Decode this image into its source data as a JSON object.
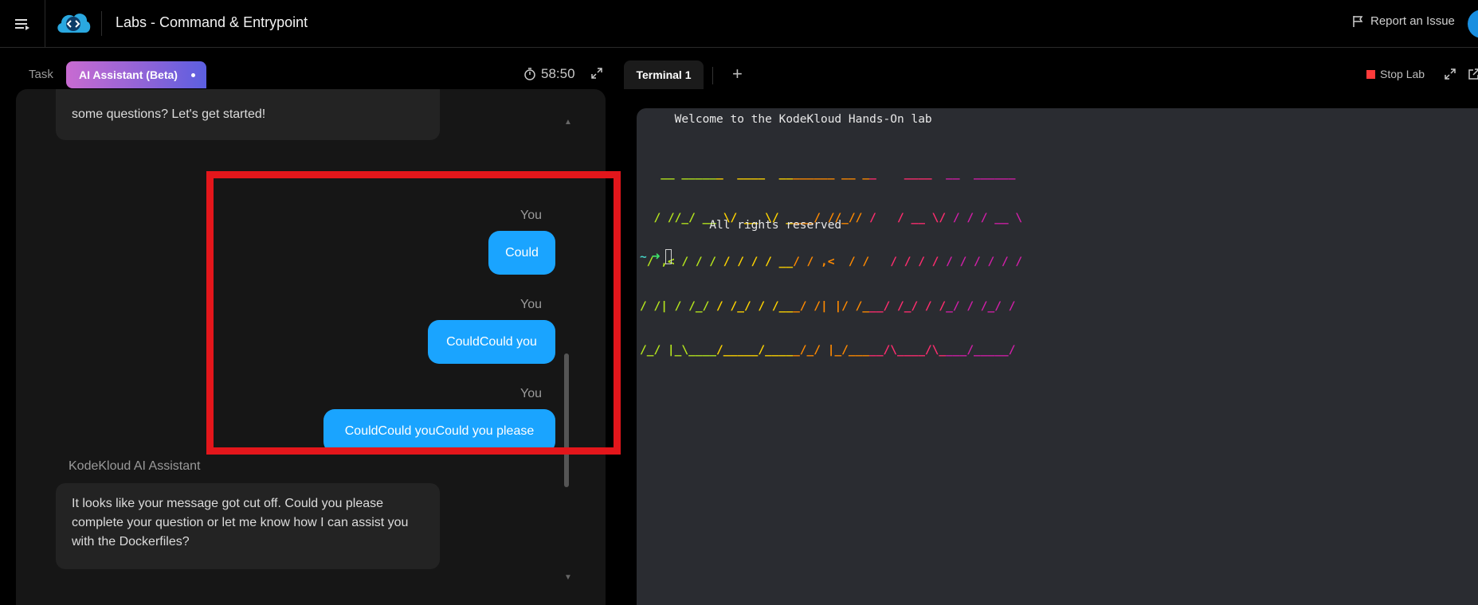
{
  "header": {
    "title": "Labs - Command & Entrypoint",
    "report_label": "Report an Issue"
  },
  "left_tabs": {
    "task": "Task",
    "ai": "AI Assistant (Beta)",
    "timer": "58:50"
  },
  "chat": {
    "top_ai_text": "some questions? Let's get started!",
    "you_label": "You",
    "user_messages": [
      "Could",
      "CouldCould you",
      "CouldCould youCould you please"
    ],
    "ai_name": "KodeKloud AI Assistant",
    "ai_reply": "It looks like your message got cut off. Could you please complete your question or let me know how I can assist you with the Dockerfiles?"
  },
  "terminal": {
    "tab_label": "Terminal 1",
    "add_label": "+",
    "stop_label": "Stop Lab",
    "welcome": "     Welcome to the KodeKloud Hands-On lab",
    "ascii_lines": [
      "   __ ______  ____  ________ __ __    ____  __  ______",
      "  / //_/ __ \\/ __ \\/ ____/ //_// /   / __ \\/ / / / __ \\",
      " / ,< / / / / / / / __/ / ,<  / /   / / / / / / / / / /",
      "/ /| / /_/ / /_/ / /___/ /| |/ /___/ /_/ / /_/ / /_/ /",
      "/_/ |_\\____/_____/_____/_/ |_/_____/\\____/\\____/_____/"
    ],
    "rights": "          All rights reserved",
    "prompt_tilde": "~",
    "prompt_arrow": "➜",
    "colors": {
      "ascii_gradient": [
        "#b5e61d",
        "#ffd400",
        "#ff8a00",
        "#ff2d6f",
        "#d11fa8"
      ]
    }
  },
  "colors": {
    "accent_blue": "#1aa4ff",
    "highlight_red": "#e3161b",
    "tab_gradient_start": "#c86bd1",
    "tab_gradient_end": "#5b5fe0"
  }
}
